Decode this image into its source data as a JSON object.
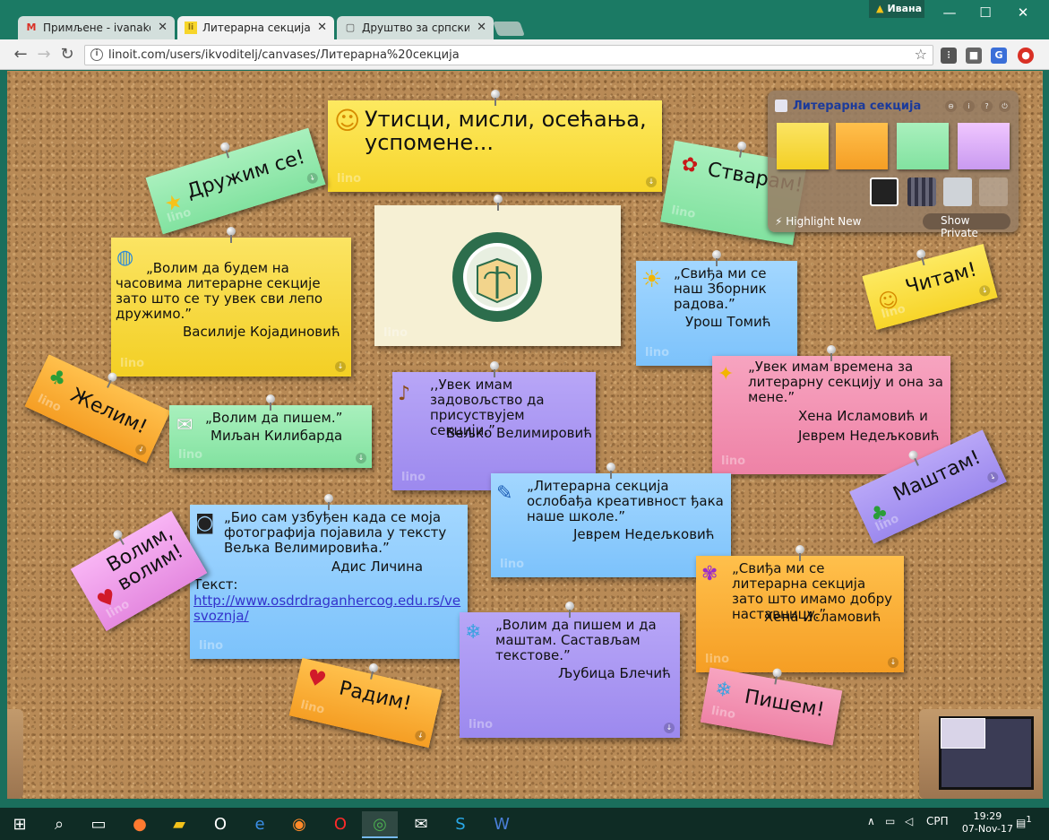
{
  "browser": {
    "tabs": [
      {
        "label": "Примљене - ivanakovac",
        "favicon": "gmail-icon",
        "favicon_glyph": "M",
        "favicon_color": "#d93025"
      },
      {
        "label": "Литерарна секција - lino",
        "favicon": "linoit-icon",
        "favicon_glyph": "li",
        "favicon_color": "#8a6d0b"
      },
      {
        "label": "Друштво за српски језик",
        "favicon": "page-icon",
        "favicon_glyph": "▢",
        "favicon_color": "#555"
      }
    ],
    "tab_close": "✕",
    "user_name": "Ивана",
    "user_warning": "▲",
    "window_controls": {
      "minimize": "—",
      "maximize": "☐",
      "close": "✕"
    },
    "url": "linoit.com/users/ikvoditelj/canvases/Литерарна%20секција",
    "url_info": "i",
    "bookmark_star": "☆"
  },
  "board": {
    "title_note": "Утисци, мисли, осећања, успомене...",
    "watermark": "lino",
    "arrow": "↓",
    "logo": {
      "ring_text_top": "ОШ \"ДР ДРАГАН ХЕРЦОГ\"",
      "ring_text_bottom": "ГРАД"
    },
    "labels": {
      "druzim": "Дружим се!",
      "stvaram": "Стварам!",
      "citam": "Читам!",
      "zelim": "Желим!",
      "mastam": "Маштам!",
      "volim": "Волим, волим!",
      "radim": "Радим!",
      "pisem": "Пишем!"
    },
    "notes": {
      "vasilije": {
        "text": "„Волим да будем на часовима литерарне секције зато што се ту увек сви лепо дружимо.”",
        "author": "Василије Којадиновић"
      },
      "urosh": {
        "text": "„Свиђа ми се наш Зборник радова.”",
        "author": "Урош Томић"
      },
      "hena_jevrem": {
        "text": "„Увек имам времена за литерарну секцију и она за мене.”",
        "author1": "Хена Исламовић и",
        "author2": "Јеврем Недељковић"
      },
      "miljan": {
        "text": "„Волим да пишем.”",
        "author": "Миљан Килибарда"
      },
      "veljko": {
        "text": ",,Увек имам задовољство да присуствујем секцији.”",
        "author": "Вељко Велимировић"
      },
      "jevrem": {
        "text": "„Литерарна секција ослобађа креативност ђака наше школе.”",
        "author": "Јеврем Недељковић"
      },
      "adis": {
        "text": "„Био сам узбуђен када се моја фотографија појавила у тексту Вељка Велимировића.”",
        "author": "Адис Личина",
        "link_label": "Текст:",
        "link_url": "http://www.osdrdraganhercog.edu.rs/vesvoznja/"
      },
      "hena": {
        "text": "„Свиђа ми се литерарна секција зато што имамо добру наставницу.”",
        "author": "Хена Исламовић"
      },
      "ljubica": {
        "text": "„Волим да пишем и да маштам. Састављам текстове.”",
        "author": "Љубица Блечић"
      }
    }
  },
  "panel": {
    "title": "Литерарна секција",
    "controls": [
      "⊖",
      "i",
      "?",
      "⏻"
    ],
    "highlight_new": "Highlight New",
    "show_private": "Show Private"
  },
  "taskbar": {
    "language": "СРП",
    "time": "19:29",
    "date": "07-Nov-17",
    "notifications": "1"
  },
  "colors": {
    "board": "#b88a56",
    "titlebar": "#1b7a64",
    "panel_title": "#1b3a9b"
  }
}
